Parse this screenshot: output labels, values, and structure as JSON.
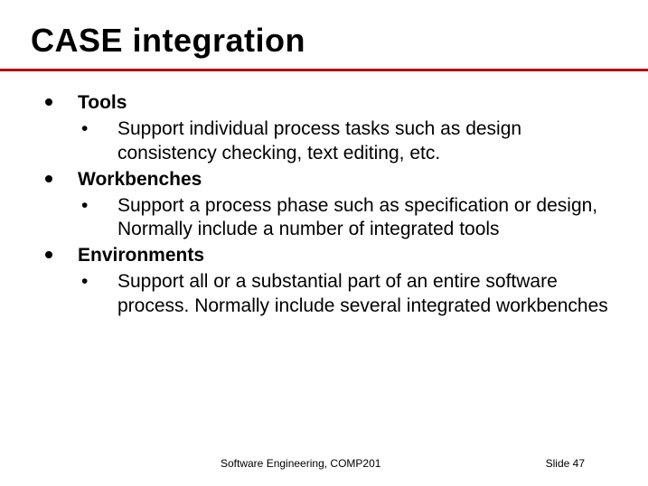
{
  "title": "CASE integration",
  "items": [
    {
      "label": "Tools",
      "sub": "Support individual process tasks such as design consistency checking, text editing, etc."
    },
    {
      "label": "Workbenches",
      "sub": "Support a process phase such as specification or design, Normally include a number of integrated tools"
    },
    {
      "label": "Environments",
      "sub": "Support all or a substantial part of an entire software process. Normally include several integrated workbenches"
    }
  ],
  "footer": {
    "course": "Software Engineering, COMP201",
    "slide_label": "Slide  47"
  }
}
